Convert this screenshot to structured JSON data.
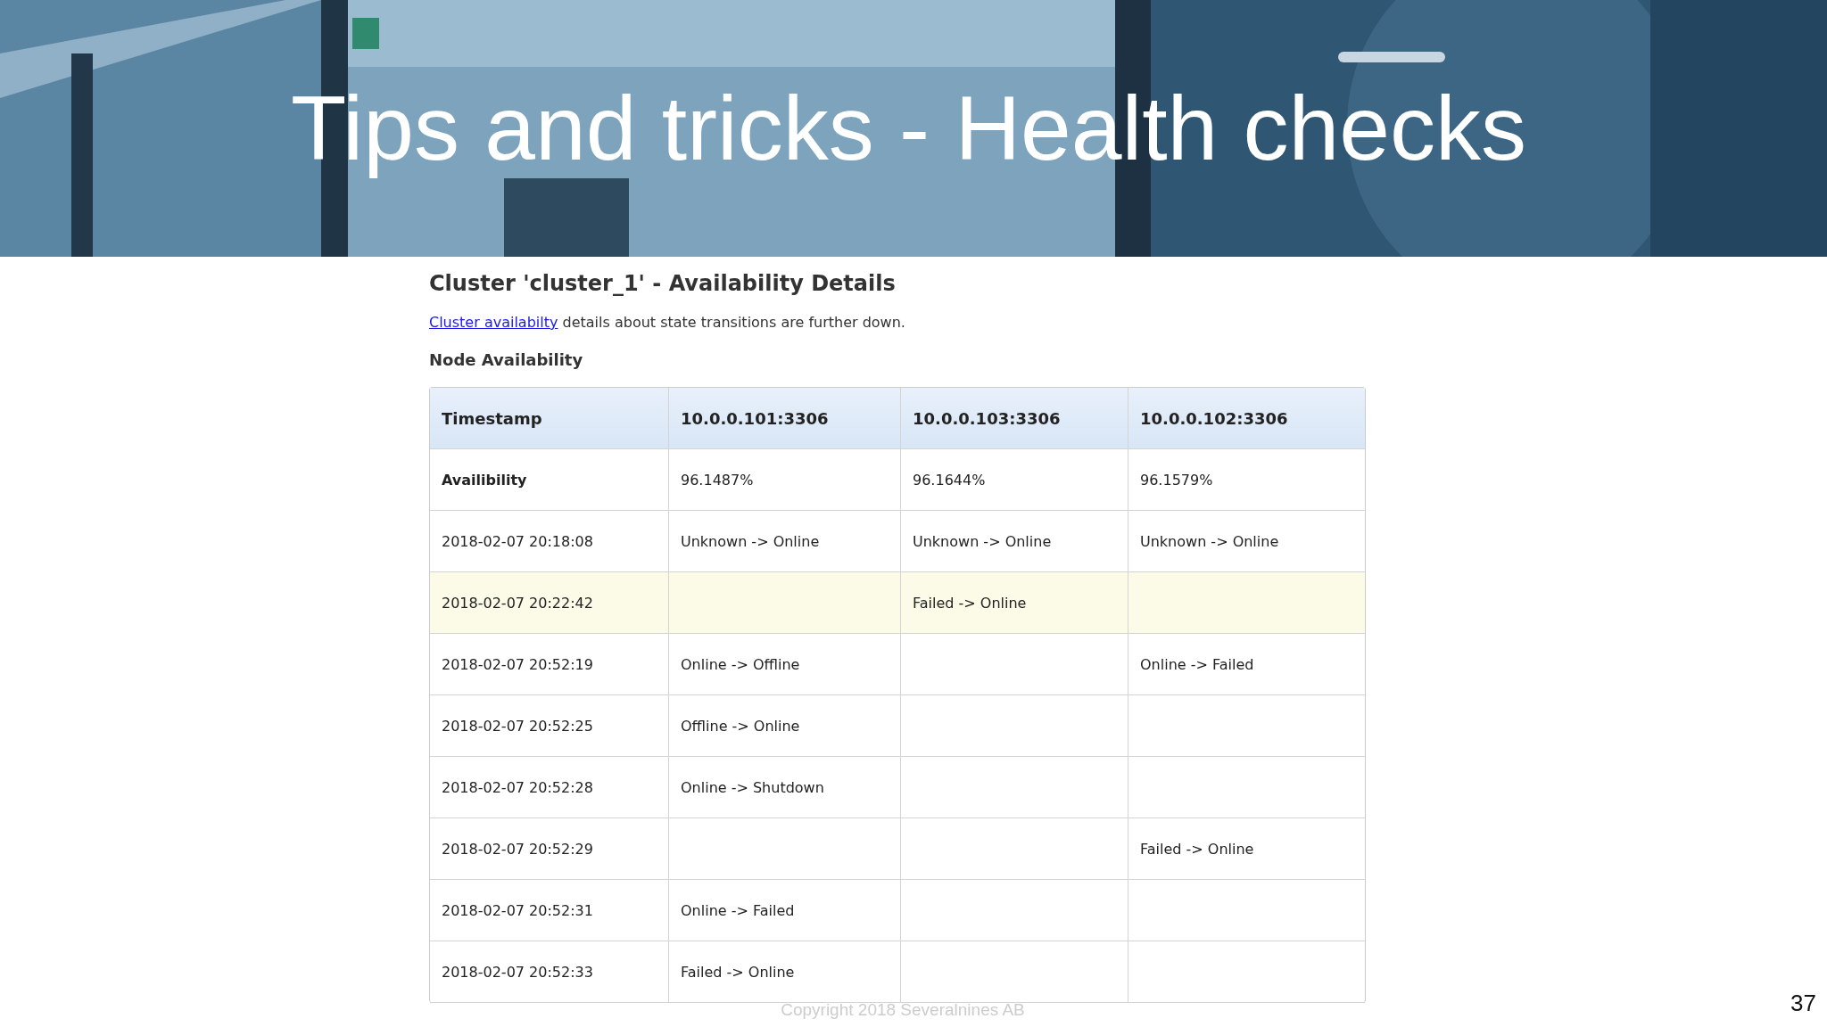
{
  "slide": {
    "title": "Tips and tricks - Health checks",
    "number": "37",
    "footer": "Copyright 2018 Severalnines AB"
  },
  "page": {
    "heading": "Cluster 'cluster_1' - Availability Details",
    "intro_link": "Cluster availabilty",
    "intro_text": " details about state transitions are further down.",
    "subheading": "Node Availability"
  },
  "table": {
    "columns": [
      "Timestamp",
      "10.0.0.101:3306",
      "10.0.0.103:3306",
      "10.0.0.102:3306"
    ],
    "rows": [
      {
        "cells": [
          "Availibility",
          "96.1487%",
          "96.1644%",
          "96.1579%"
        ],
        "highlighted": false,
        "kind": "summary"
      },
      {
        "cells": [
          "2018-02-07 20:18:08",
          "Unknown -> Online",
          "Unknown -> Online",
          "Unknown -> Online"
        ],
        "highlighted": false,
        "kind": "event"
      },
      {
        "cells": [
          "2018-02-07 20:22:42",
          "",
          "Failed -> Online",
          ""
        ],
        "highlighted": true,
        "kind": "event"
      },
      {
        "cells": [
          "2018-02-07 20:52:19",
          "Online -> Offline",
          "",
          "Online -> Failed"
        ],
        "highlighted": false,
        "kind": "event"
      },
      {
        "cells": [
          "2018-02-07 20:52:25",
          "Offline -> Online",
          "",
          ""
        ],
        "highlighted": false,
        "kind": "event"
      },
      {
        "cells": [
          "2018-02-07 20:52:28",
          "Online -> Shutdown",
          "",
          ""
        ],
        "highlighted": false,
        "kind": "event"
      },
      {
        "cells": [
          "2018-02-07 20:52:29",
          "",
          "",
          "Failed -> Online"
        ],
        "highlighted": false,
        "kind": "event"
      },
      {
        "cells": [
          "2018-02-07 20:52:31",
          "Online -> Failed",
          "",
          ""
        ],
        "highlighted": false,
        "kind": "event"
      },
      {
        "cells": [
          "2018-02-07 20:52:33",
          "Failed -> Online",
          "",
          ""
        ],
        "highlighted": false,
        "kind": "event"
      }
    ]
  }
}
